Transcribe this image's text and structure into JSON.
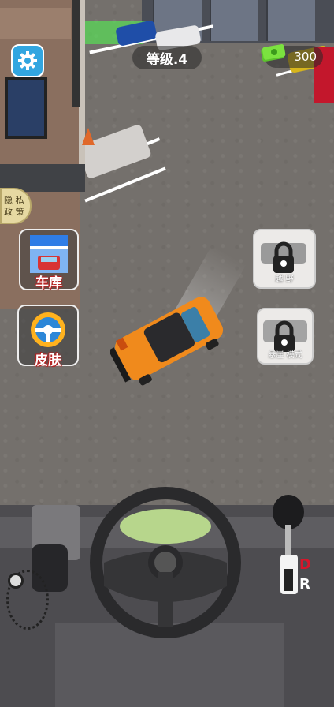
{
  "hud": {
    "level_label": "等级.4",
    "money_value": "300"
  },
  "left_menu": {
    "privacy_line1": "隐 私",
    "privacy_line2": "政 策",
    "garage_label": "车库",
    "skin_label": "皮肤"
  },
  "right_menu": {
    "offroad_label": "越 野",
    "mode_label": "悬崖 模式"
  },
  "controls": {
    "gear_drive": "D",
    "gear_reverse": "R"
  },
  "icons": {
    "settings": "gear-icon",
    "money": "cash-icon",
    "garage": "storefront-icon",
    "skin": "steering-wheel-icon",
    "lock": "lock-icon"
  },
  "colors": {
    "player_car": "#f08a1c",
    "settings_bg": "#32a6e0",
    "gear_drive": "#d7152a"
  }
}
